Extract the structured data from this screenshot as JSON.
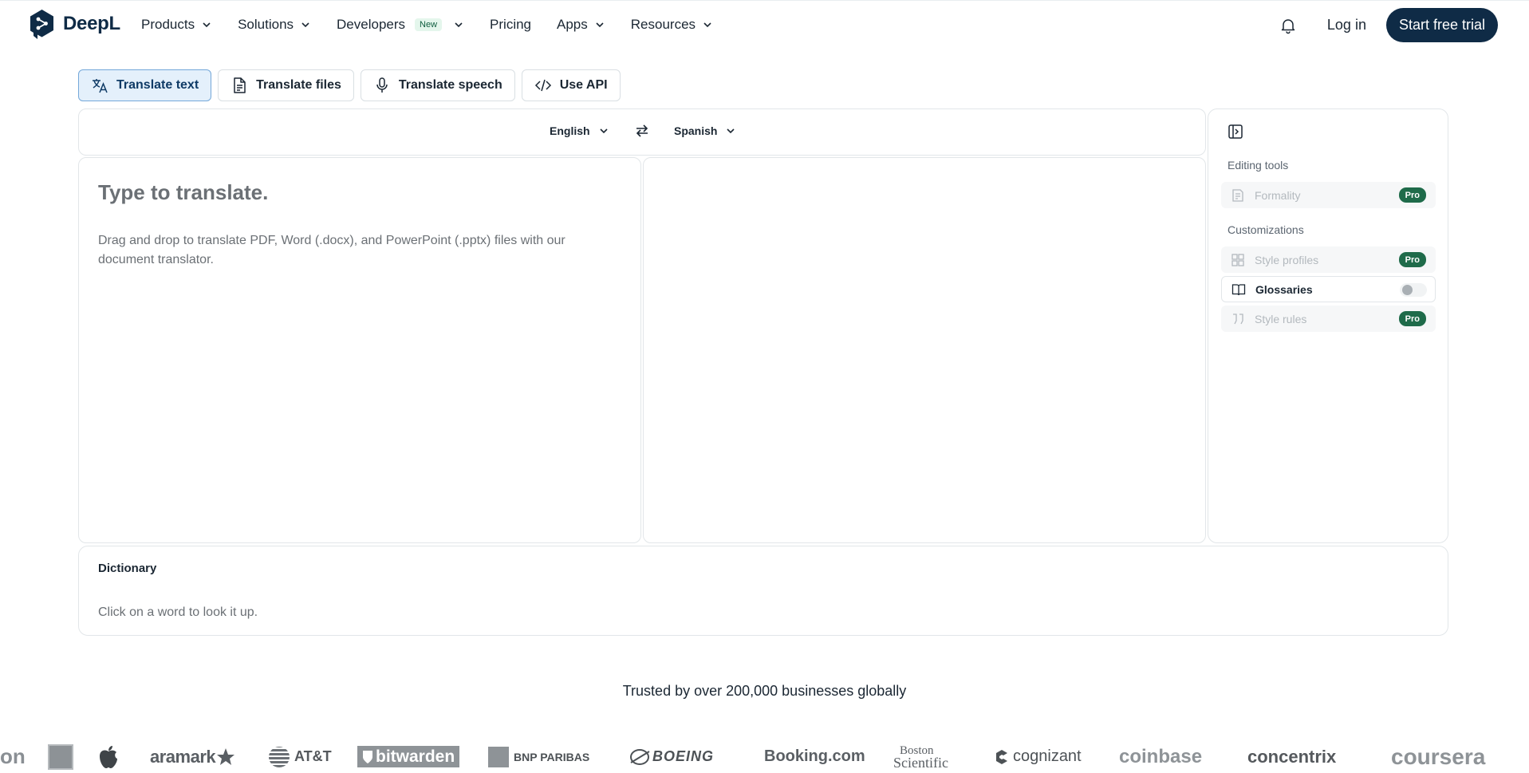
{
  "nav": {
    "brand": "DeepL",
    "items": [
      {
        "label": "Products",
        "has_dropdown": true
      },
      {
        "label": "Solutions",
        "has_dropdown": true
      },
      {
        "label": "Developers",
        "badge": "New",
        "has_dropdown": true
      },
      {
        "label": "Pricing",
        "has_dropdown": false
      },
      {
        "label": "Apps",
        "has_dropdown": true
      },
      {
        "label": "Resources",
        "has_dropdown": true
      }
    ],
    "login": "Log in",
    "cta": "Start free trial",
    "icons": {
      "notifications": "bell-icon"
    }
  },
  "tabs": [
    {
      "label": "Translate text",
      "icon": "translate-icon",
      "active": true
    },
    {
      "label": "Translate files",
      "icon": "document-icon",
      "active": false
    },
    {
      "label": "Translate speech",
      "icon": "microphone-icon",
      "active": false
    },
    {
      "label": "Use API",
      "icon": "code-icon",
      "active": false
    }
  ],
  "translator": {
    "source_lang": "English",
    "target_lang": "Spanish",
    "placeholder": "Type to translate.",
    "hint": "Drag and drop to translate PDF, Word (.docx), and PowerPoint (.pptx) files with our document translator."
  },
  "side_panel": {
    "editing_tools_heading": "Editing tools",
    "formality": {
      "label": "Formality",
      "badge": "Pro"
    },
    "customizations_heading": "Customizations",
    "style_profiles": {
      "label": "Style profiles",
      "badge": "Pro"
    },
    "glossaries": {
      "label": "Glossaries",
      "toggle_on": false
    },
    "style_rules": {
      "label": "Style rules",
      "badge": "Pro"
    }
  },
  "dictionary": {
    "title": "Dictionary",
    "hint": "Click on a word to look it up."
  },
  "trust": {
    "text": "Trusted by over 200,000 businesses globally",
    "logos": {
      "partial_left": "on",
      "aramark": "aramark",
      "att": "AT&T",
      "bitwarden": "bitwarden",
      "bnp": "BNP PARIBAS",
      "boeing": "BOEING",
      "booking": "Booking.com",
      "boston_1": "Boston",
      "boston_2": "Scientific",
      "cognizant": "cognizant",
      "coinbase": "coinbase",
      "concentrix": "concentrix",
      "coursera": "coursera"
    }
  },
  "colors": {
    "brand_navy": "#0f2b46",
    "active_tab_bg": "#e4f0fb",
    "pro_badge": "#1f6b4a"
  }
}
